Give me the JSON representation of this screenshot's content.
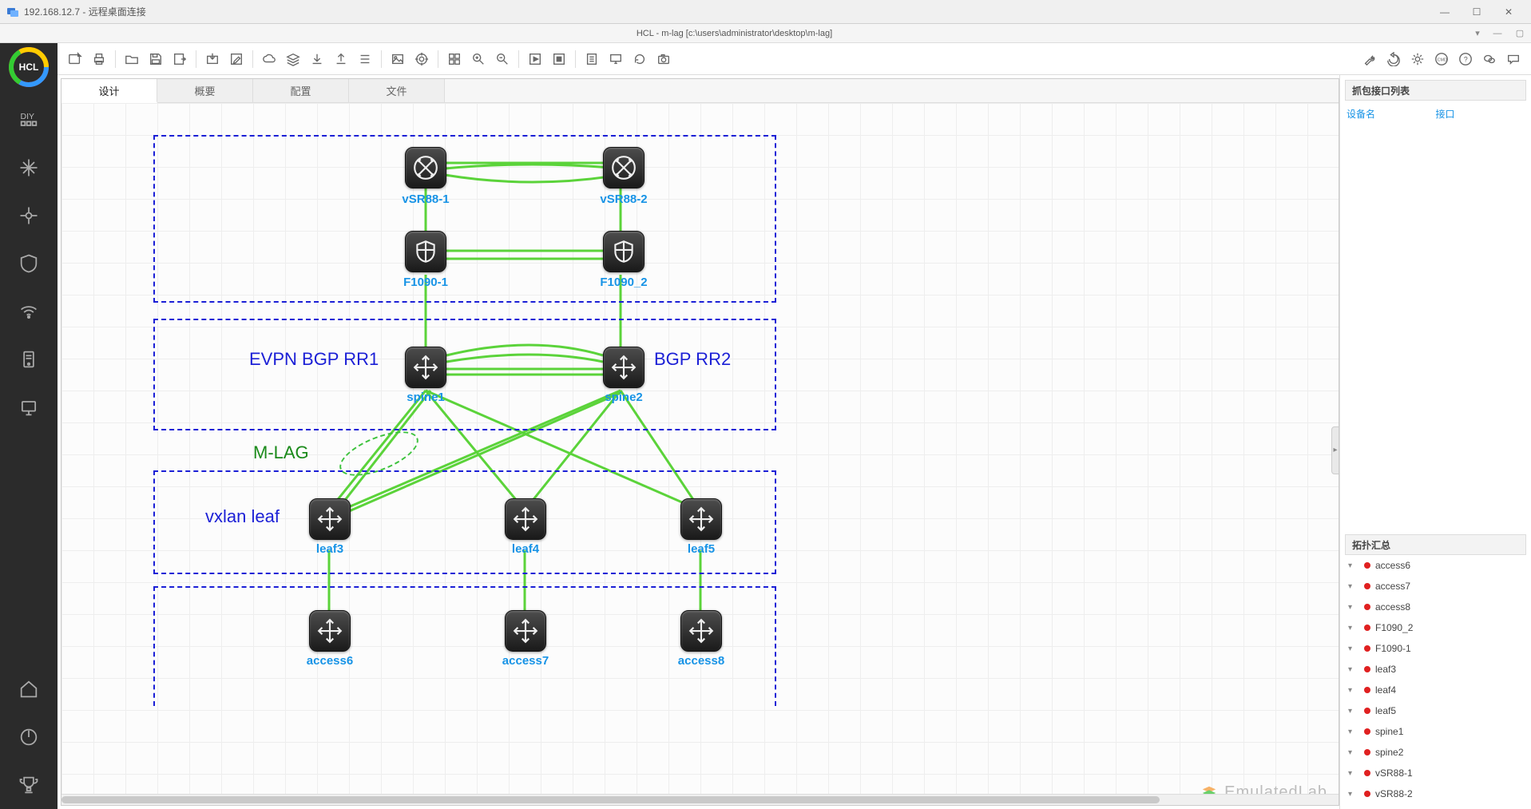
{
  "outer_window": {
    "title": "192.168.12.7 - 远程桌面连接"
  },
  "inner_window": {
    "title": "HCL - m-lag [c:\\users\\administrator\\desktop\\m-lag]"
  },
  "logo": "HCL",
  "tabs": {
    "design": "设计",
    "overview": "概要",
    "config": "配置",
    "file": "文件"
  },
  "right_panel": {
    "capture_title": "抓包接口列表",
    "col_device": "设备名",
    "col_iface": "接口",
    "topo_title": "拓扑汇总"
  },
  "labels": {
    "evpn_rr1": "EVPN BGP RR1",
    "bgp_rr2": "BGP RR2",
    "mlag": "M-LAG",
    "vxlan_leaf": "vxlan leaf"
  },
  "nodes": {
    "vsr1": "vSR88-1",
    "vsr2": "vSR88-2",
    "fw1": "F1090-1",
    "fw2": "F1090_2",
    "spine1": "spine1",
    "spine2": "spine2",
    "leaf3": "leaf3",
    "leaf4": "leaf4",
    "leaf5": "leaf5",
    "access6": "access6",
    "access7": "access7",
    "access8": "access8"
  },
  "topo_list": [
    "access6",
    "access7",
    "access8",
    "F1090_2",
    "F1090-1",
    "leaf3",
    "leaf4",
    "leaf5",
    "spine1",
    "spine2",
    "vSR88-1",
    "vSR88-2"
  ],
  "watermark": "EmulatedLab"
}
